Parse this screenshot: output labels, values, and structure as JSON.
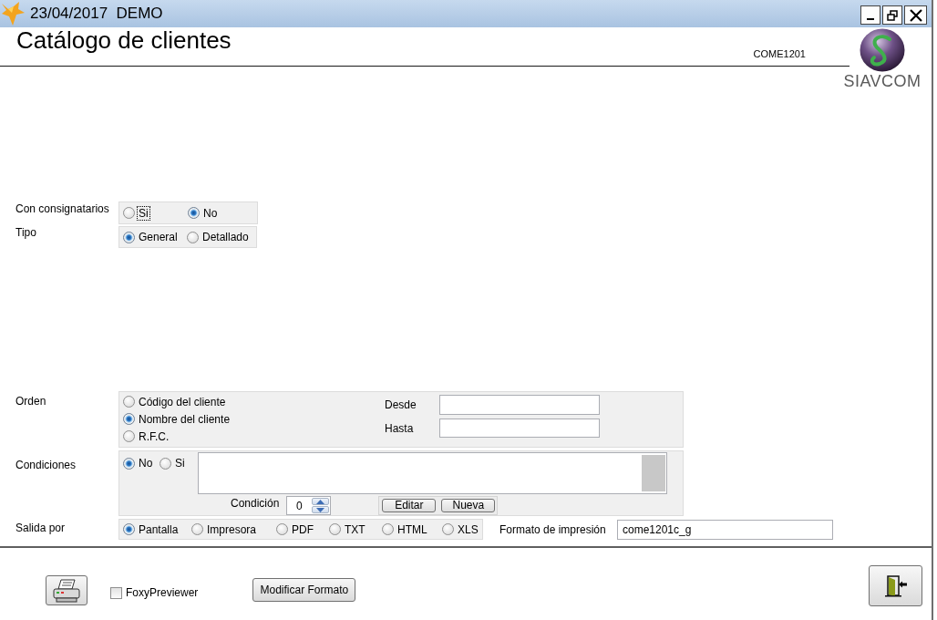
{
  "window": {
    "title": "23/04/2017  DEMO"
  },
  "header": {
    "title": "Catálogo de clientes",
    "code": "COME1201",
    "logo_text": "SIAVCOM"
  },
  "con_consignatarios": {
    "label": "Con consignatarios",
    "options": [
      {
        "label": "Si",
        "selected": false,
        "focused": true
      },
      {
        "label": "No",
        "selected": true,
        "focused": false
      }
    ]
  },
  "tipo": {
    "label": "Tipo",
    "options": [
      {
        "label": "General",
        "selected": true
      },
      {
        "label": "Detallado",
        "selected": false
      }
    ]
  },
  "orden": {
    "label": "Orden",
    "options": [
      {
        "label": "Código del cliente",
        "selected": false
      },
      {
        "label": "Nombre del cliente",
        "selected": true
      },
      {
        "label": "R.F.C.",
        "selected": false
      }
    ],
    "desde": {
      "label": "Desde"
    },
    "hasta": {
      "label": "Hasta"
    }
  },
  "condiciones": {
    "label": "Condiciones",
    "options": [
      {
        "label": "No",
        "selected": true
      },
      {
        "label": "Si",
        "selected": false
      }
    ],
    "condicion": {
      "label": "Condición",
      "value": "0"
    },
    "buttons": [
      "Editar",
      "Nueva"
    ]
  },
  "salida_por": {
    "label": "Salida por",
    "options": [
      {
        "label": "Pantalla",
        "selected": true
      },
      {
        "label": "Impresora",
        "selected": false
      },
      {
        "label": "PDF",
        "selected": false
      },
      {
        "label": "TXT",
        "selected": false
      },
      {
        "label": "HTML",
        "selected": false
      },
      {
        "label": "XLS",
        "selected": false
      }
    ]
  },
  "formato_impresion": {
    "label": "Formato de impresión",
    "value": "come1201c_g"
  },
  "footer": {
    "foxy_previewer": {
      "label": "FoxyPreviewer",
      "checked": false
    },
    "modify_button": "Modificar Formato"
  }
}
